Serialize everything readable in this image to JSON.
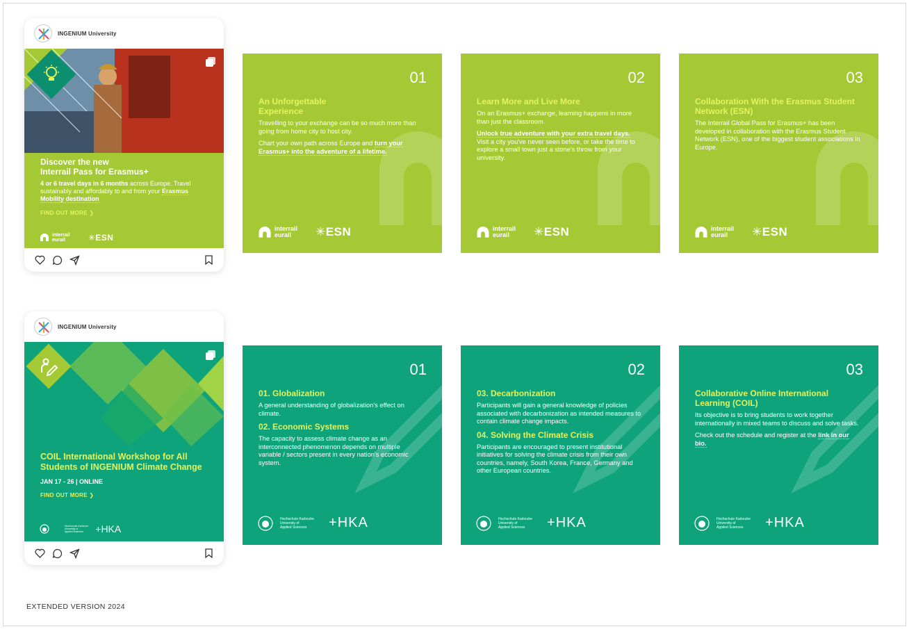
{
  "row1": {
    "post": {
      "account": "INGENIUM University",
      "headline": "Discover the new\nInterrail Pass for Erasmus+",
      "text_bold1": "4 or 6 travel days in 6 months",
      "text1": " across Europe. Travel sustainably and affordably to and from your ",
      "text_bold2": "Erasmus Mobility destination",
      "cta": "FIND OUT MORE ❯"
    },
    "slides": [
      {
        "num": "01",
        "title": "An Unforgettable Experience",
        "p1": "Travelling to your exchange can be so much more than going from home city to host city.",
        "p2a": "Chart your own path across Europe and ",
        "p2b": "turn your Erasmus+ into the adventure of a lifetime."
      },
      {
        "num": "02",
        "title": "Learn More and Live More",
        "p1": "On an Erasmus+ exchange, learning happens in more than just the classroom.",
        "p2a": "Unlock true adventure with your extra travel days.",
        "p2b": " Visit a city you've never seen before, or take the time to explore a small town just a stone's throw from your university."
      },
      {
        "num": "03",
        "title": "Collaboration With the Erasmus Student Network (ESN)",
        "p1": "The Interrail Global Pass for Erasmus+ has been developed in collaboration with the Erasmus Student Network (ESN), one of the biggest student associations in Europe."
      }
    ],
    "logo_interrail": "interrail\neurail",
    "logo_esn": "ESN"
  },
  "row2": {
    "post": {
      "account": "INGENIUM University",
      "headline": "COIL International Workshop for All Students of INGENIUM Climate Change",
      "dates": "JAN 17 - 26 | ONLINE",
      "cta": "FIND OUT MORE ❯"
    },
    "slides": [
      {
        "num": "01",
        "t1": "01. Globalization",
        "p1": "A general understanding of globalization's effect on climate.",
        "t2": "02. Economic Systems",
        "p2": "The capacity to assess climate change as an interconnected phenomenon depends on multiple variable / sectors present in every nation's economic system."
      },
      {
        "num": "02",
        "t1": "03. Decarbonization",
        "p1": "Participants will gain a general knowledge of policies associated with decarbonization as intended measures to contain climate change impacts.",
        "t2": "04. Solving the Climate Crisis",
        "p2": "Participants are encouraged to present institutional initiatives for solving the climate crisis from their own countries, namely, South Korea, France, Germany and other European countries."
      },
      {
        "num": "03",
        "t1": "Collaborative Online International Learning (COIL)",
        "p1": "Its objective is to bring students to work together internationally in mixed teams to discuss and solve tasks.",
        "p2a": "Check out the schedule and register at the ",
        "p2b": "link in our bio."
      }
    ],
    "logo_hska": "Hochschule Karlsruhe\nUniversity of\nApplied Sciences",
    "logo_hka": "HKA"
  },
  "footer": "EXTENDED VERSION 2024",
  "colors": {
    "lime": "#a4c934",
    "teal": "#0ea37a",
    "accent": "#e3f45f"
  }
}
